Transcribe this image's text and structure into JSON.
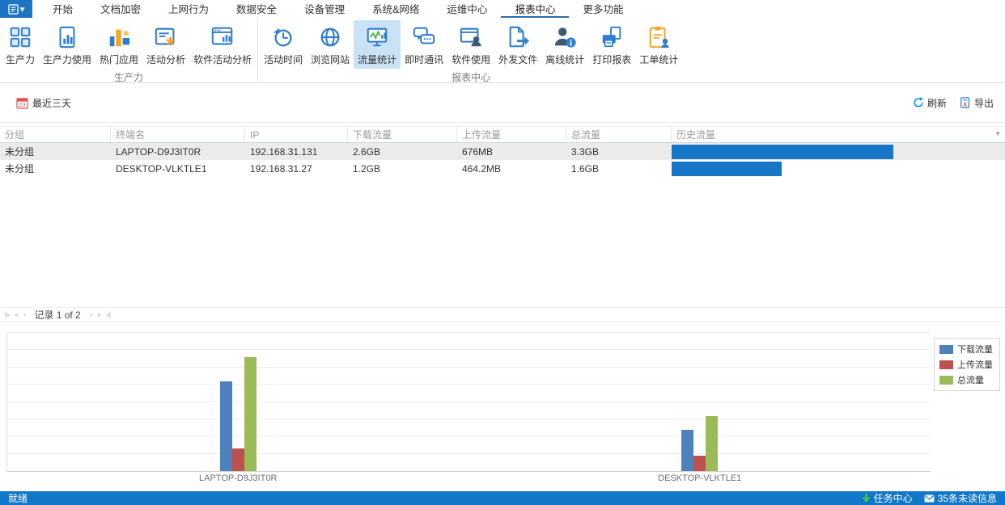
{
  "colors": {
    "accent_blue": "#1d73c4",
    "ribbon_selected_bg": "#c9e2f6",
    "history_bar": "#1776c8",
    "status_bar_bg": "#1177c8",
    "row_alt_bg": "#ebebeb"
  },
  "menu": {
    "app_button_caret": "▾",
    "tabs": [
      {
        "label": "开始",
        "selected": false
      },
      {
        "label": "文档加密",
        "selected": false
      },
      {
        "label": "上网行为",
        "selected": false
      },
      {
        "label": "数据安全",
        "selected": false
      },
      {
        "label": "设备管理",
        "selected": false
      },
      {
        "label": "系统&网络",
        "selected": false
      },
      {
        "label": "运维中心",
        "selected": false
      },
      {
        "label": "报表中心",
        "selected": true
      },
      {
        "label": "更多功能",
        "selected": false
      }
    ]
  },
  "ribbon": {
    "groups": [
      {
        "label": "生产力",
        "items": [
          {
            "label": "生产力",
            "icon": "productivity-grid-icon",
            "selected": false
          },
          {
            "label": "生产力使用",
            "icon": "productivity-usage-icon",
            "selected": false
          },
          {
            "label": "热门应用",
            "icon": "hot-apps-icon",
            "selected": false
          },
          {
            "label": "活动分析",
            "icon": "activity-analysis-icon",
            "selected": false
          },
          {
            "label": "软件活动分析",
            "icon": "software-activity-analysis-icon",
            "selected": false
          }
        ]
      },
      {
        "label": "报表中心",
        "items": [
          {
            "label": "活动时间",
            "icon": "activity-time-icon",
            "selected": false
          },
          {
            "label": "浏览网站",
            "icon": "browse-website-icon",
            "selected": false
          },
          {
            "label": "流量统计",
            "icon": "traffic-stats-icon",
            "selected": true
          },
          {
            "label": "即时通讯",
            "icon": "instant-messaging-icon",
            "selected": false
          },
          {
            "label": "软件使用",
            "icon": "software-usage-icon",
            "selected": false
          },
          {
            "label": "外发文件",
            "icon": "outgoing-files-icon",
            "selected": false
          },
          {
            "label": "离线统计",
            "icon": "offline-stats-icon",
            "selected": false
          },
          {
            "label": "打印报表",
            "icon": "print-report-icon",
            "selected": false
          },
          {
            "label": "工单统计",
            "icon": "work-order-stats-icon",
            "selected": false
          }
        ]
      }
    ]
  },
  "toolbar": {
    "date_range": "最近三天",
    "date_icon": "calendar-icon",
    "refresh_label": "刷新",
    "export_label": "导出"
  },
  "table": {
    "columns": [
      "分组",
      "终端名",
      "IP",
      "下载流量",
      "上传流量",
      "总流量",
      "历史流量"
    ],
    "filter_caret": "▼",
    "rows": [
      {
        "group": "未分组",
        "terminal": "LAPTOP-D9J3IT0R",
        "ip": "192.168.31.131",
        "download": "2.6GB",
        "upload": "676MB",
        "total": "3.3GB",
        "history_pct": 66.5
      },
      {
        "group": "未分组",
        "terminal": "DESKTOP-VLKTLE1",
        "ip": "192.168.31.27",
        "download": "1.2GB",
        "upload": "464.2MB",
        "total": "1.6GB",
        "history_pct": 33.0
      }
    ]
  },
  "pagination": {
    "controls": [
      "|«",
      "«",
      "‹",
      "›",
      "»",
      "»|"
    ],
    "record_text": "记录 1 of 2"
  },
  "chart_data": {
    "type": "bar",
    "categories": [
      "LAPTOP-D9J3IT0R",
      "DESKTOP-VLKTLE1"
    ],
    "series": [
      {
        "name": "下载流量",
        "color": "#4f81bd",
        "values_gb": [
          2.6,
          1.2
        ]
      },
      {
        "name": "上传流量",
        "color": "#c0504d",
        "values_gb": [
          0.66,
          0.453
        ]
      },
      {
        "name": "总流量",
        "color": "#9bbb59",
        "values_gb": [
          3.3,
          1.6
        ]
      }
    ],
    "title": "",
    "xlabel": "",
    "ylabel": "",
    "ylim_gb": [
      0,
      4
    ],
    "gridline_step_gb": 0.5,
    "gridlines": 8,
    "grid": true,
    "legend_position": "top-right"
  },
  "status_bar": {
    "state": "就绪",
    "task_center": "任务中心",
    "unread": "35条未读信息"
  }
}
